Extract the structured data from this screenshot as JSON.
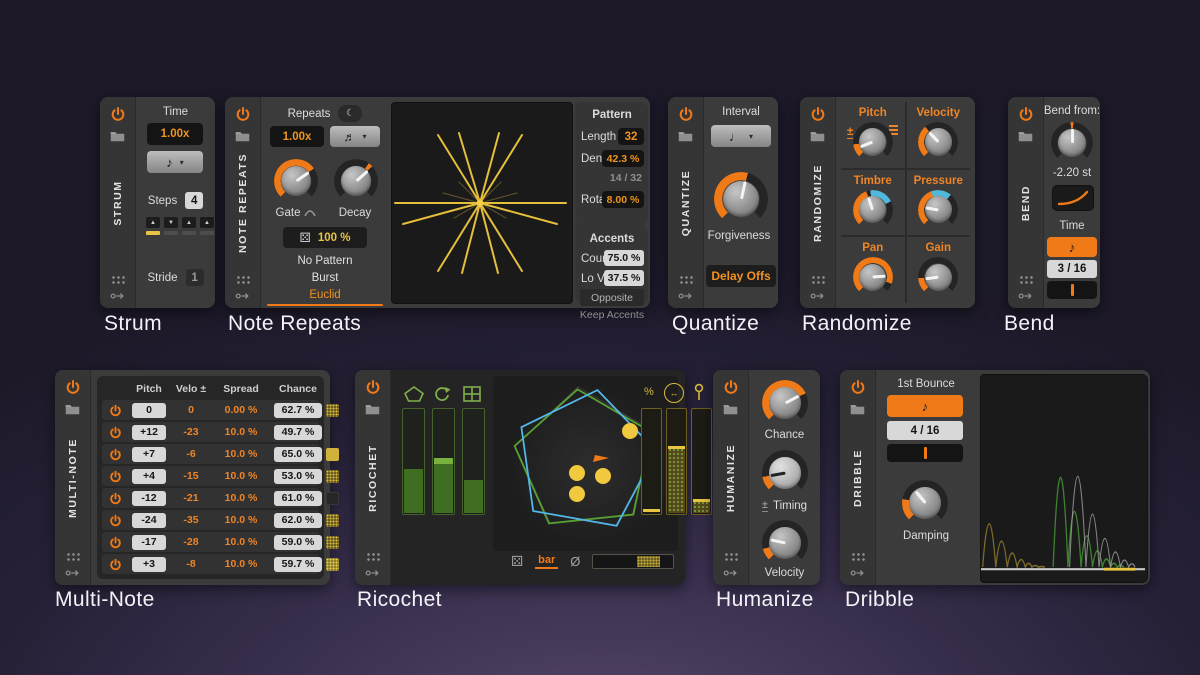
{
  "colors": {
    "accent": "#f07a17",
    "value_orange": "#f0941e",
    "yellow": "#e7c442",
    "cyan": "#4fb8dc",
    "green": "#4d8f2f",
    "blue": "#53b6e8"
  },
  "glyphs": {
    "caret": "▾",
    "moon": "☾",
    "die": "⚄",
    "note8": "♪",
    "note16": "♬",
    "note4": "♩",
    "plusminus": "±",
    "empty_set": "Ø",
    "arrows": "↔",
    "percent": "%",
    "dash": "—",
    "up": "▲",
    "down": "▼"
  },
  "captions": {
    "strum": "Strum",
    "note_repeats": "Note Repeats",
    "quantize": "Quantize",
    "randomize": "Randomize",
    "bend": "Bend",
    "multi_note": "Multi-Note",
    "ricochet": "Ricochet",
    "humanize": "Humanize",
    "dribble": "Dribble"
  },
  "strum": {
    "name": "STRUM",
    "time_label": "Time",
    "time_value": "1.00x",
    "steps_label": "Steps",
    "steps_value": "4",
    "stride_label": "Stride",
    "stride_value": "1"
  },
  "note_repeats": {
    "name": "NOTE REPEATS",
    "repeats_label": "Repeats",
    "rate_value": "1.00x",
    "gate_label": "Gate",
    "decay_label": "Decay",
    "dice_value": "100 %",
    "modes": [
      "No Pattern",
      "Burst",
      "Euclid"
    ],
    "selected_mode": "Euclid",
    "pattern": {
      "title": "Pattern",
      "length_label": "Length",
      "length": "32",
      "density_label": "Density",
      "density": "42.3 %",
      "fraction": "14 / 32",
      "rotate_label": "Rotate",
      "rotate": "8.00 %"
    },
    "accents": {
      "title": "Accents",
      "count_label": "Count",
      "count": "75.0 %",
      "lovel_label": "Lo Vel.",
      "lovel": "37.5 %",
      "opposite": "Opposite",
      "keep": "Keep Accents"
    }
  },
  "quantize": {
    "name": "QUANTIZE",
    "interval_label": "Interval",
    "knob_label": "Forgiveness",
    "delay_offs": "Delay Offs"
  },
  "randomize": {
    "name": "RANDOMIZE",
    "cells": [
      {
        "label": "Pitch"
      },
      {
        "label": "Velocity"
      },
      {
        "label": "Timbre"
      },
      {
        "label": "Pressure"
      },
      {
        "label": "Pan"
      },
      {
        "label": "Gain"
      }
    ]
  },
  "bend": {
    "name": "BEND",
    "from_label": "Bend from:",
    "amount": "-2.20 st",
    "time_label": "Time",
    "division": "3 / 16"
  },
  "multi_note": {
    "name": "MULTI-NOTE",
    "columns": {
      "pitch": "Pitch",
      "velo": "Velo ±",
      "spread": "Spread",
      "chance": "Chance"
    },
    "rows": [
      {
        "pitch": "0",
        "velo": "0",
        "spread": "0.00 %",
        "chance": "62.7 %"
      },
      {
        "pitch": "+12",
        "velo": "-23",
        "spread": "10.0 %",
        "chance": "49.7 %"
      },
      {
        "pitch": "+7",
        "velo": "-6",
        "spread": "10.0 %",
        "chance": "65.0 %"
      },
      {
        "pitch": "+4",
        "velo": "-15",
        "spread": "10.0 %",
        "chance": "53.0 %"
      },
      {
        "pitch": "-12",
        "velo": "-21",
        "spread": "10.0 %",
        "chance": "61.0 %"
      },
      {
        "pitch": "-24",
        "velo": "-35",
        "spread": "10.0 %",
        "chance": "62.0 %"
      },
      {
        "pitch": "-17",
        "velo": "-28",
        "spread": "10.0 %",
        "chance": "59.0 %"
      },
      {
        "pitch": "+3",
        "velo": "-8",
        "spread": "10.0 %",
        "chance": "59.7 %"
      }
    ]
  },
  "ricochet": {
    "name": "RICOCHET",
    "bottom_mode": "bar"
  },
  "humanize": {
    "name": "HUMANIZE",
    "knob1": "Chance",
    "knob2": "Timing",
    "knob3": "Velocity"
  },
  "dribble": {
    "name": "DRIBBLE",
    "bounce_label": "1st Bounce",
    "division": "4 / 16",
    "damping_label": "Damping"
  }
}
